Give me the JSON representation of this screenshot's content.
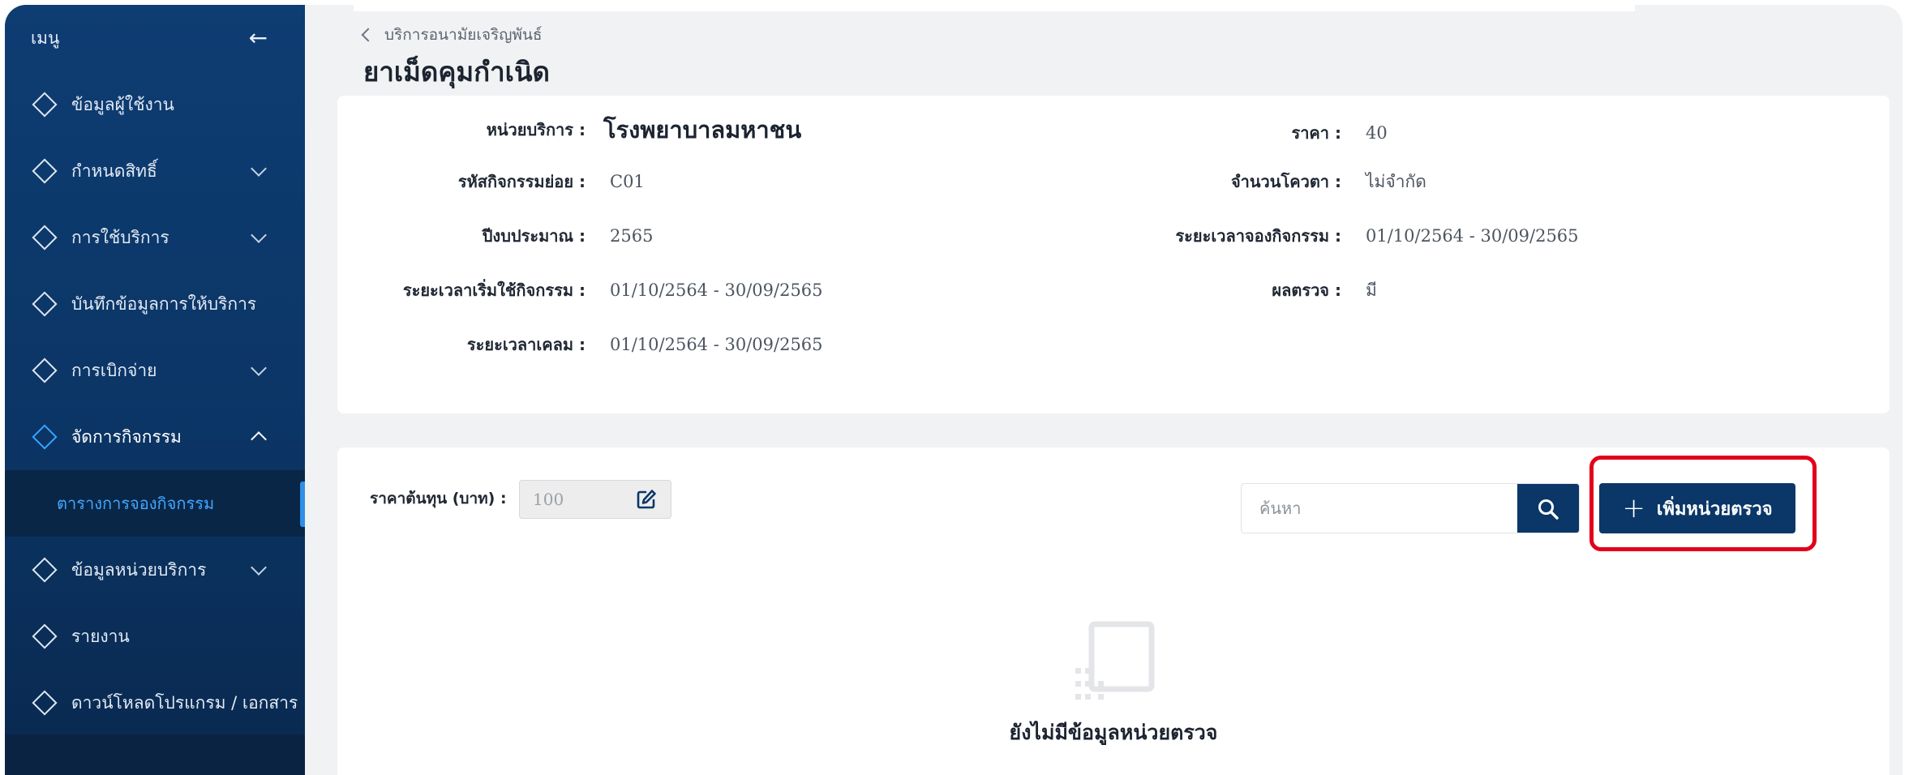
{
  "sidebar": {
    "title": "เมนู",
    "items": [
      {
        "label": "ข้อมูลผู้ใช้งาน",
        "expandable": false
      },
      {
        "label": "กำหนดสิทธิ์",
        "expandable": true
      },
      {
        "label": "การใช้บริการ",
        "expandable": true
      },
      {
        "label": "บันทึกข้อมูลการให้บริการ",
        "expandable": false
      },
      {
        "label": "การเบิกจ่าย",
        "expandable": true
      },
      {
        "label": "จัดการกิจกรรม",
        "expandable": true,
        "expanded": true
      },
      {
        "label": "ข้อมูลหน่วยบริการ",
        "expandable": true
      },
      {
        "label": "รายงาน",
        "expandable": false
      },
      {
        "label": "ดาวน์โหลดโปรแกรม / เอกสาร",
        "expandable": false
      }
    ],
    "sub_items": [
      {
        "label": "ตารางการจองกิจกรรม",
        "selected": true
      }
    ]
  },
  "header": {
    "breadcrumb": "บริการอนามัยเจริญพันธ์",
    "title": "ยาเม็ดคุมกำเนิด"
  },
  "info": {
    "left": [
      {
        "label": "หน่วยบริการ :",
        "value": "โรงพยาบาลมหาชน"
      },
      {
        "label": "รหัสกิจกรรมย่อย :",
        "value": "C01"
      },
      {
        "label": "ปีงบประมาณ :",
        "value": "2565"
      },
      {
        "label": "ระยะเวลาเริ่มใช้กิจกรรม :",
        "value": "01/10/2564 - 30/09/2565"
      },
      {
        "label": "ระยะเวลาเคลม :",
        "value": "01/10/2564 - 30/09/2565"
      }
    ],
    "right": [
      {
        "label": "ราคา :",
        "value": "40"
      },
      {
        "label": "จำนวนโควตา :",
        "value": "ไม่จำกัด"
      },
      {
        "label": "ระยะเวลาจองกิจกรรม :",
        "value": "01/10/2564 - 30/09/2565"
      },
      {
        "label": "ผลตรวจ :",
        "value": "มี"
      }
    ]
  },
  "list": {
    "cost_label": "ราคาต้นทุน (บาท) :",
    "cost_value": "100",
    "search_placeholder": "ค้นหา",
    "add_button_plus": "+",
    "add_button_label": "เพิ่มหน่วยตรวจ",
    "empty_message": "ยังไม่มีข้อมูลหน่วยตรวจ"
  },
  "colors": {
    "sidebar_bg": "#0e3d73",
    "primary": "#0a3768",
    "active_accent": "#41a6ff",
    "highlight": "#e3001b"
  }
}
